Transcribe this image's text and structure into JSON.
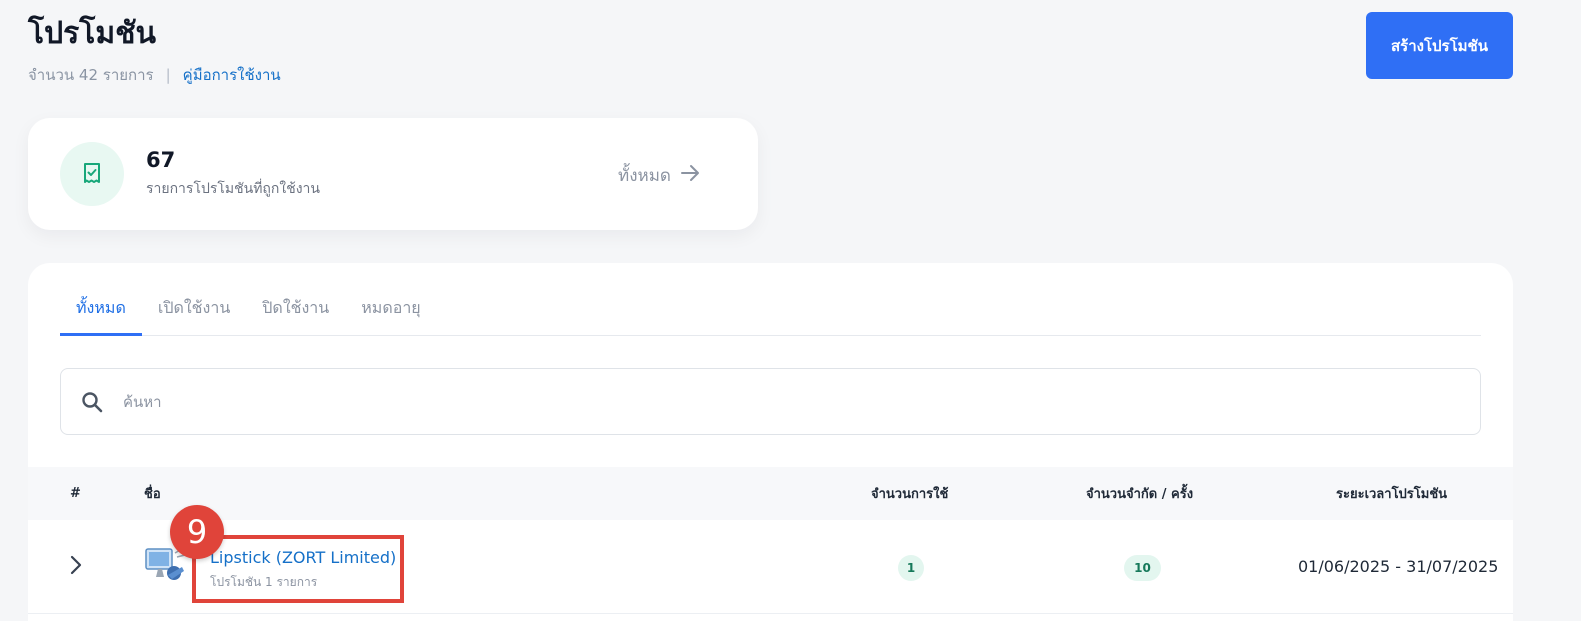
{
  "header": {
    "title": "โปรโมชัน",
    "count_text": "จำนวน 42 รายการ",
    "separator": "|",
    "guide_link": "คู่มือการใช้งาน",
    "create_button": "สร้างโปรโมชัน"
  },
  "stat_card": {
    "value": "67",
    "label": "รายการโปรโมชันที่ถูกใช้งาน",
    "view_all": "ทั้งหมด"
  },
  "tabs": [
    {
      "label": "ทั้งหมด",
      "active": true
    },
    {
      "label": "เปิดใช้งาน",
      "active": false
    },
    {
      "label": "ปิดใช้งาน",
      "active": false
    },
    {
      "label": "หมดอายุ",
      "active": false
    }
  ],
  "search": {
    "placeholder": "ค้นหา",
    "value": ""
  },
  "table": {
    "columns": {
      "index": "#",
      "name": "ชื่อ",
      "usage": "จำนวนการใช้",
      "limit": "จำนวนจำกัด / ครั้ง",
      "period": "ระยะเวลาโปรโมชัน"
    },
    "rows": [
      {
        "name": "Lipstick (ZORT Limited)",
        "sub": "โปรโมชัน 1 รายการ",
        "usage": "1",
        "limit": "10",
        "period": "01/06/2025 - 31/07/2025"
      }
    ]
  },
  "annotation": {
    "marker": "9"
  },
  "colors": {
    "primary": "#2f6ff5",
    "link": "#1570c8",
    "highlight": "#e0443a",
    "success_bg": "#e3f6ef",
    "success_text": "#16795a"
  },
  "icons": {
    "stat": "receipt-check-icon",
    "view_all": "arrow-right-icon",
    "search": "search-icon",
    "expand": "chevron-right-icon",
    "thumbnail": "product-thumbnail"
  }
}
